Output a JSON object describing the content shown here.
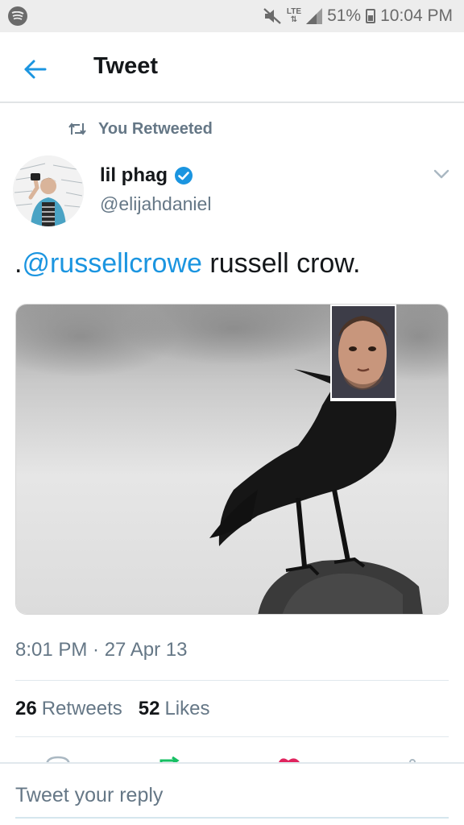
{
  "status_bar": {
    "signal_label": "LTE",
    "battery": "51%",
    "time": "10:04 PM"
  },
  "header": {
    "title": "Tweet"
  },
  "retweet": {
    "label": "You Retweeted"
  },
  "author": {
    "name": "lil phag",
    "handle": "@elijahdaniel"
  },
  "tweet": {
    "prefix": ".",
    "mention": "@russellcrowe",
    "text": " russell crow.",
    "timestamp": "8:01 PM · 27 Apr 13"
  },
  "stats": {
    "retweets_count": "26",
    "retweets_label": "Retweets",
    "likes_count": "52",
    "likes_label": "Likes"
  },
  "reply": {
    "placeholder": "Tweet your reply"
  },
  "colors": {
    "accent": "#1b95e0",
    "muted_text": "#657786",
    "like": "#e0245e",
    "retweet": "#17bf63"
  }
}
